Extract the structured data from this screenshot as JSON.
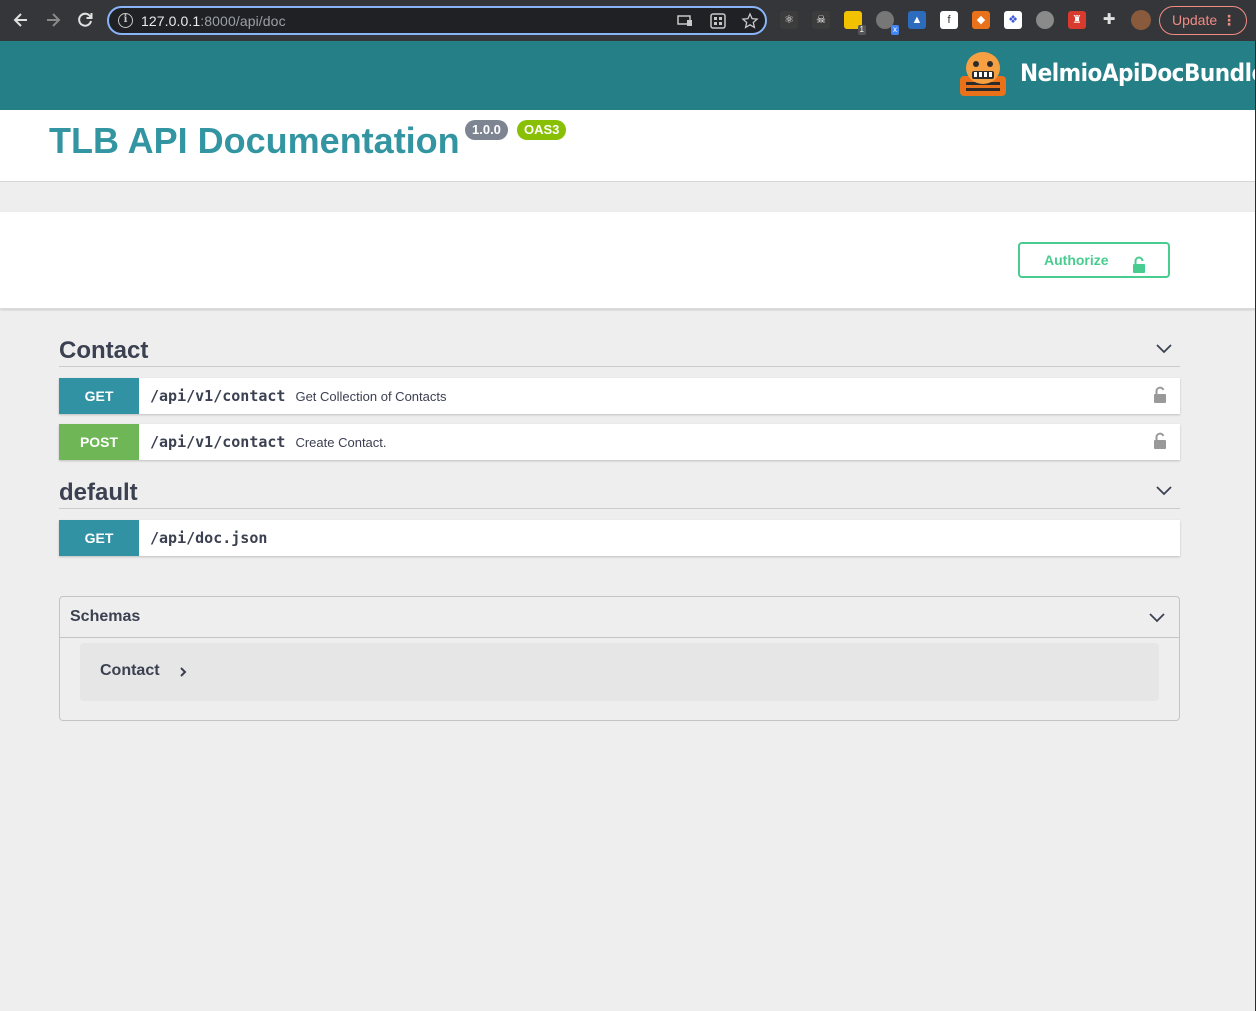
{
  "browser": {
    "url_host": "127.0.0.1",
    "url_rest": ":8000/api/doc",
    "update_label": "Update",
    "extension_badges": [
      "1",
      "x"
    ]
  },
  "header": {
    "logo_text": "NelmioApiDocBundle"
  },
  "info": {
    "title": "TLB API Documentation",
    "version": "1.0.0",
    "oas_badge": "OAS3"
  },
  "scheme": {
    "authorize_label": "Authorize"
  },
  "tags": [
    {
      "name": "Contact",
      "operations": [
        {
          "method": "GET",
          "path": "/api/v1/contact",
          "summary": "Get Collection of Contacts",
          "locked": true
        },
        {
          "method": "POST",
          "path": "/api/v1/contact",
          "summary": "Create Contact.",
          "locked": true
        }
      ]
    },
    {
      "name": "default",
      "operations": [
        {
          "method": "GET",
          "path": "/api/doc.json",
          "summary": "",
          "locked": false
        }
      ]
    }
  ],
  "schemas": {
    "title": "Schemas",
    "models": [
      "Contact"
    ]
  },
  "colors": {
    "topbar": "#247f86",
    "title": "#3295a1",
    "get": "#3192a4",
    "post": "#6fb656",
    "authorize": "#49cc90",
    "badge_version": "#7d8492",
    "badge_oas": "#89bf04"
  },
  "icons": [
    "back-arrow-icon",
    "forward-arrow-icon",
    "reload-icon",
    "info-icon",
    "cast-icon",
    "apps-icon",
    "star-icon",
    "extensions-icon",
    "profile-avatar-icon",
    "menu-dots-icon",
    "lock-icon",
    "chevron-down-icon",
    "chevron-right-icon"
  ]
}
